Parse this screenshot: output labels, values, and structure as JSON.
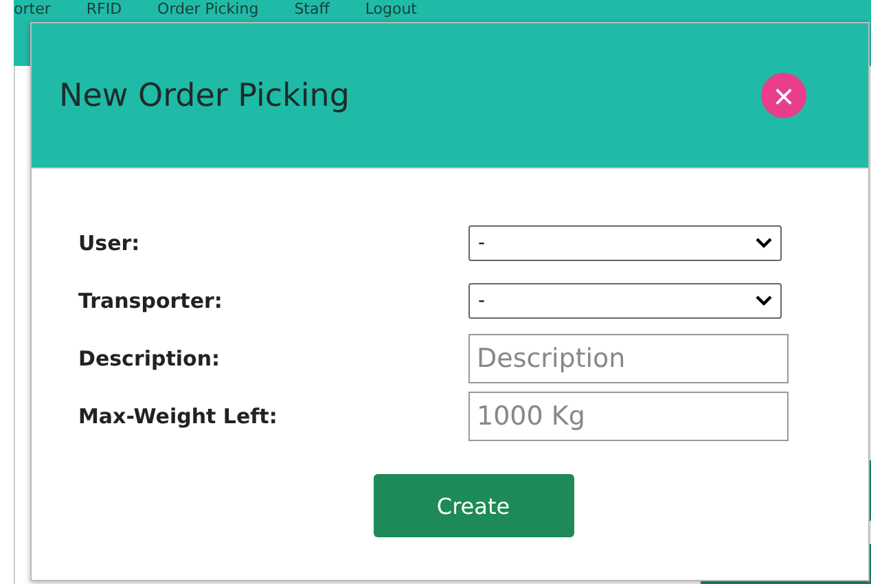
{
  "nav": {
    "items": [
      "orter",
      "RFID",
      "Order Picking",
      "Staff",
      "Logout"
    ]
  },
  "dialog": {
    "title": "New Order Picking",
    "close": "×",
    "fields": [
      {
        "kind": "select",
        "label": "User:",
        "value": "-"
      },
      {
        "kind": "select",
        "label": "Transporter:",
        "value": "-"
      },
      {
        "kind": "input",
        "label": "Description:",
        "placeholder": "Description"
      },
      {
        "kind": "input",
        "label": "Max-Weight Left:",
        "placeholder": "1000 Kg"
      }
    ],
    "submit": "Create"
  }
}
